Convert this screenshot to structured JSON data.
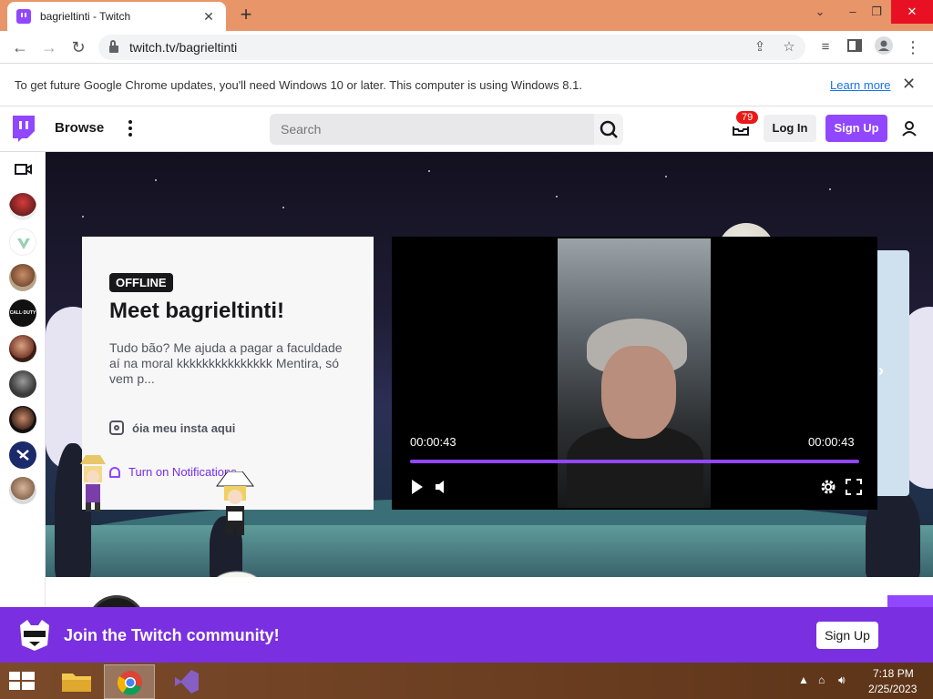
{
  "browser": {
    "tab_title": "bagrieltinti - Twitch",
    "tab_close": "✕",
    "new_tab": "+",
    "minimize": "⌄",
    "restore": "–",
    "maximize": "❐",
    "close": "✕",
    "url": "twitch.tv/bagrieltinti"
  },
  "infobar": {
    "text": "To get future Google Chrome updates, you'll need Windows 10 or later. This computer is using Windows 8.1.",
    "link": "Learn more",
    "close": "✕"
  },
  "twitch_nav": {
    "browse": "Browse",
    "search_placeholder": "Search",
    "inbox_count": "79",
    "login": "Log In",
    "signup": "Sign Up"
  },
  "channel": {
    "status": "OFFLINE",
    "headline": "Meet bagrieltinti!",
    "bio": "Tudo bão? Me ajuda a pagar a faculdade aí na moral kkkkkkkkkkkkkkk Mentira, só vem p...",
    "social_link": "óia meu insta aqui",
    "notifications": "Turn on Notifications"
  },
  "player": {
    "elapsed": "00:00:43",
    "duration": "00:00:43",
    "progress": 1.0
  },
  "community": {
    "text": "Join the Twitch community!",
    "signup": "Sign Up"
  },
  "taskbar": {
    "time": "7:18 PM",
    "date": "2/25/2023"
  },
  "colors": {
    "twitch_purple": "#9146ff",
    "banner_purple": "#7a2fe0",
    "badge_red": "#e91916"
  }
}
